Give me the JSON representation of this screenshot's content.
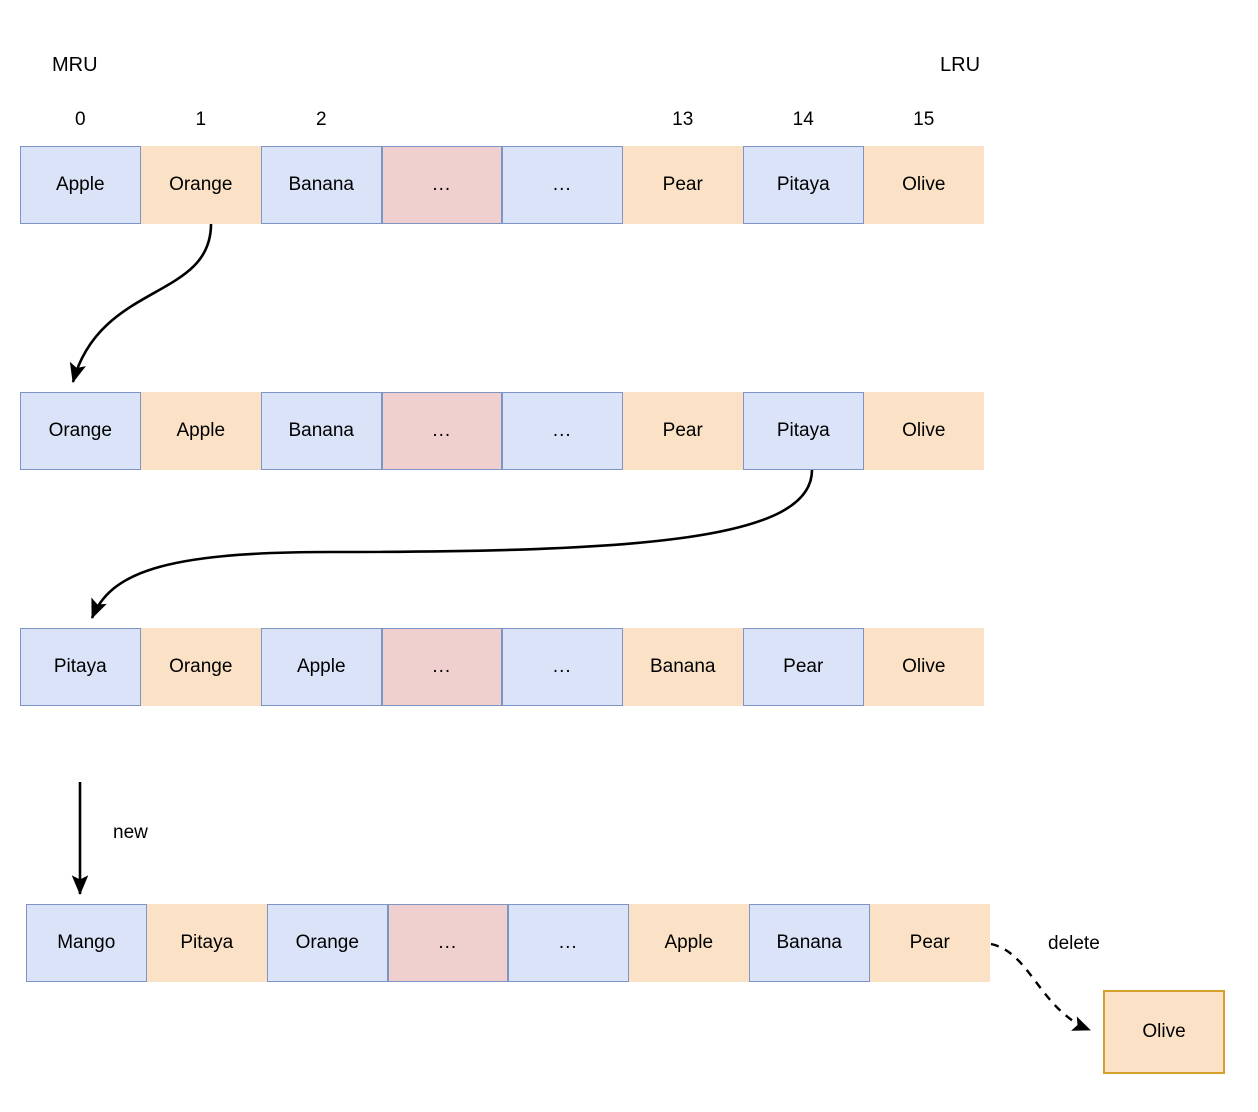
{
  "diagram": {
    "title_labels": {
      "mru": "MRU",
      "lru": "LRU"
    },
    "indices": [
      "0",
      "1",
      "2",
      "",
      "",
      "13",
      "14",
      "15"
    ],
    "edge_labels": {
      "new": "new",
      "delete": "delete"
    },
    "colors": {
      "blue_fill": "#dae3f7",
      "blue_border": "#7d94c4",
      "orange_fill": "#fbe2c6",
      "pink_fill": "#f0cfcf",
      "gold_border": "#d6a02c",
      "arrow": "#000000"
    },
    "rows": [
      {
        "id": "row-1",
        "cells": [
          {
            "label": "Apple",
            "style": "blue"
          },
          {
            "label": "Orange",
            "style": "orange"
          },
          {
            "label": "Banana",
            "style": "blue"
          },
          {
            "label": "...",
            "style": "pink"
          },
          {
            "label": "...",
            "style": "blue"
          },
          {
            "label": "Pear",
            "style": "orange"
          },
          {
            "label": "Pitaya",
            "style": "blue"
          },
          {
            "label": "Olive",
            "style": "orange"
          }
        ]
      },
      {
        "id": "row-2",
        "cells": [
          {
            "label": "Orange",
            "style": "blue"
          },
          {
            "label": "Apple",
            "style": "orange"
          },
          {
            "label": "Banana",
            "style": "blue"
          },
          {
            "label": "...",
            "style": "pink"
          },
          {
            "label": "...",
            "style": "blue"
          },
          {
            "label": "Pear",
            "style": "orange"
          },
          {
            "label": "Pitaya",
            "style": "blue"
          },
          {
            "label": "Olive",
            "style": "orange"
          }
        ]
      },
      {
        "id": "row-3",
        "cells": [
          {
            "label": "Pitaya",
            "style": "blue"
          },
          {
            "label": "Orange",
            "style": "orange"
          },
          {
            "label": "Apple",
            "style": "blue"
          },
          {
            "label": "...",
            "style": "pink"
          },
          {
            "label": "...",
            "style": "blue"
          },
          {
            "label": "Banana",
            "style": "orange"
          },
          {
            "label": "Pear",
            "style": "blue"
          },
          {
            "label": "Olive",
            "style": "orange"
          }
        ]
      },
      {
        "id": "row-4",
        "cells": [
          {
            "label": "Mango",
            "style": "blue"
          },
          {
            "label": "Pitaya",
            "style": "orange"
          },
          {
            "label": "Orange",
            "style": "blue"
          },
          {
            "label": "...",
            "style": "pink"
          },
          {
            "label": "...",
            "style": "blue"
          },
          {
            "label": "Apple",
            "style": "orange"
          },
          {
            "label": "Banana",
            "style": "blue"
          },
          {
            "label": "Pear",
            "style": "orange"
          }
        ]
      }
    ],
    "deleted_item": {
      "label": "Olive"
    }
  }
}
